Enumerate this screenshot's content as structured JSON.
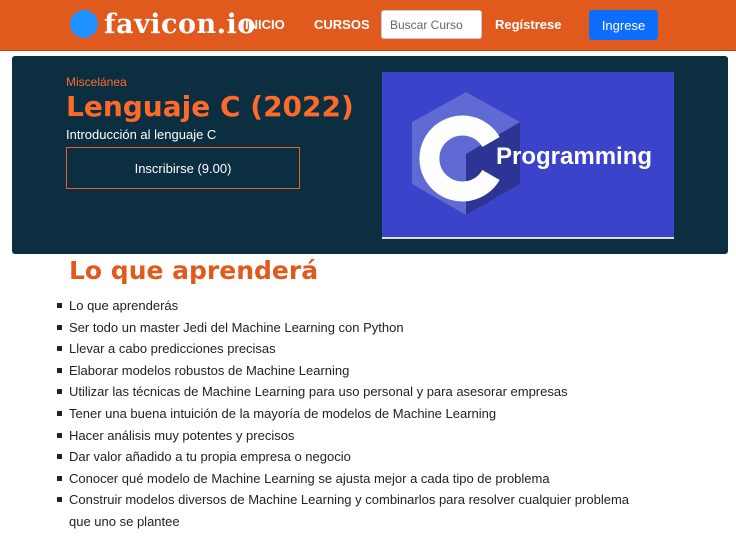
{
  "navbar": {
    "brand": "favicon.io",
    "links": [
      "INICIO",
      "CURSOS"
    ],
    "search_placeholder": "Buscar Curso",
    "register_label": "Regístrese",
    "login_label": "Ingrese"
  },
  "course": {
    "category": "Miscelánea",
    "title": "Lenguaje C (2022)",
    "subtitle": "Introducción al lenguaje C",
    "enroll_label": "Inscribirse (9.00)",
    "image_text": "Programming"
  },
  "learn": {
    "heading": "Lo que aprenderá",
    "items": [
      "Lo que aprenderás",
      "Ser todo un master Jedi del Machine Learning con Python",
      "Llevar a cabo predicciones precisas",
      "Elaborar modelos robustos de Machine Learning",
      "Utilizar las técnicas de Machine Learning para uso personal y para asesorar empresas",
      "Tener una buena intuición de la mayoría de modelos de Machine Learning",
      "Hacer análisis muy potentes y precisos",
      "Dar valor añadido a tu propia empresa o negocio",
      "Conocer qué modelo de Machine Learning se ajusta mejor a cada tipo de problema",
      "Construir modelos diversos de Machine Learning y combinarlos para resolver cualquier problema que uno se plantee"
    ]
  },
  "colors": {
    "navbar": "#e05a1e",
    "hero_bg": "#0b2e40",
    "accent": "#ff6a2b",
    "login_button": "#0d6efd",
    "image_bg": "#3a43c9"
  }
}
